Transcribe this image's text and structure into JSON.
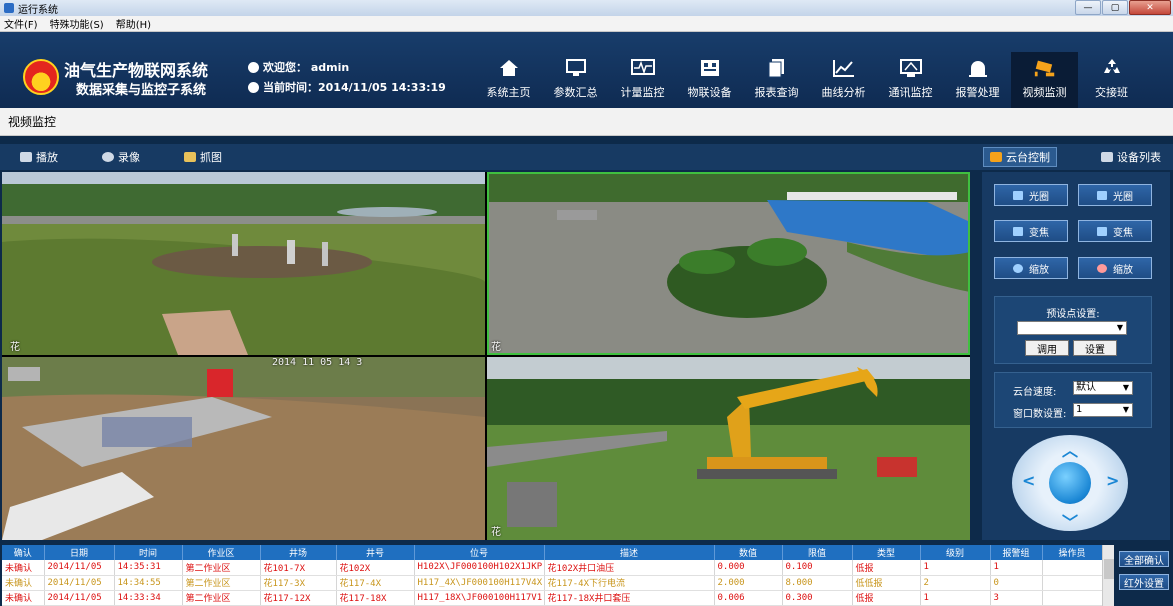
{
  "window": {
    "title": "运行系统",
    "controls": [
      "—",
      "▢",
      "✕"
    ]
  },
  "menu": [
    "文件(F)",
    "特殊功能(S)",
    "帮助(H)"
  ],
  "header": {
    "title1": "油气生产物联网系统",
    "title2": "数据采集与监控子系统",
    "welcome": "欢迎您： admin",
    "time": "当前时间：2014/11/05 14:33:19"
  },
  "nav": [
    {
      "label": "系统主页",
      "icon": "home-icon"
    },
    {
      "label": "参数汇总",
      "icon": "monitor-icon"
    },
    {
      "label": "计量监控",
      "icon": "waveform-icon"
    },
    {
      "label": "物联设备",
      "icon": "device-icon"
    },
    {
      "label": "报表查询",
      "icon": "report-icon"
    },
    {
      "label": "曲线分析",
      "icon": "chart-icon"
    },
    {
      "label": "通讯监控",
      "icon": "comm-icon"
    },
    {
      "label": "报警处理",
      "icon": "alarm-bell-icon"
    },
    {
      "label": "视频监测",
      "icon": "camera-icon",
      "active": true
    },
    {
      "label": "交接班",
      "icon": "recycle-icon"
    }
  ],
  "breadcrumb": "视频监控",
  "toolbar": {
    "play": "播放",
    "record": "录像",
    "capture": "抓图",
    "ptz": "云台控制",
    "devices": "设备列表"
  },
  "video": {
    "osd": [
      {
        "label": "花",
        "time": ""
      },
      {
        "label": "花",
        "time": ""
      },
      {
        "label": "",
        "time": "2014 11 05 14 3"
      },
      {
        "label": "花",
        "time": ""
      }
    ]
  },
  "ptz": {
    "buttons": [
      "光圈",
      "光圈",
      "变焦",
      "变焦",
      "缩放",
      "缩放"
    ],
    "preset_label": "预设点设置:",
    "preset_value": "",
    "call": "调用",
    "set": "设置",
    "speed_label": "云台速度:",
    "speed_value": "默认",
    "window_label": "窗口数设置:",
    "window_value": "1"
  },
  "alarm": {
    "headers": [
      "确认",
      "日期",
      "时间",
      "作业区",
      "井场",
      "井号",
      "位号",
      "描述",
      "数值",
      "限值",
      "类型",
      "级别",
      "报警组",
      "操作员"
    ],
    "rows": [
      [
        "未确认",
        "2014/11/05",
        "14:35:31",
        "第二作业区",
        "花101-7X",
        "花102X",
        "H102X\\JF000100H102X1JKP",
        "花102X井口油压",
        "0.000",
        "0.100",
        "低报",
        "1",
        "1",
        ""
      ],
      [
        "未确认",
        "2014/11/05",
        "14:34:55",
        "第二作业区",
        "花117-3X",
        "花117-4X",
        "H117_4X\\JF000100H117V4X",
        "花117-4X下行电流",
        "2.000",
        "8.000",
        "低低报",
        "2",
        "0",
        ""
      ],
      [
        "未确认",
        "2014/11/05",
        "14:33:34",
        "第二作业区",
        "花117-12X",
        "花117-18X",
        "H117_18X\\JF000100H117V1",
        "花117-18X井口套压",
        "0.006",
        "0.300",
        "低报",
        "1",
        "3",
        ""
      ]
    ]
  },
  "side_buttons": [
    "全部确认",
    "红外设置"
  ]
}
